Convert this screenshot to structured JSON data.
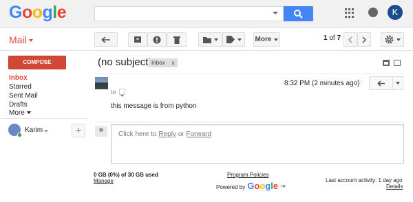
{
  "header": {
    "logo_letters": [
      "G",
      "o",
      "o",
      "g",
      "l",
      "e"
    ],
    "logo_colors": [
      "#4285f4",
      "#ea4335",
      "#fbbc05",
      "#4285f4",
      "#34a853",
      "#ea4335"
    ],
    "search": {
      "value": "",
      "placeholder": ""
    },
    "account_initial": "K"
  },
  "toolbar": {
    "mail_label": "Mail",
    "more_label": "More",
    "pager_current": "1",
    "pager_of": "of",
    "pager_total": "7"
  },
  "sidebar": {
    "compose_label": "COMPOSE",
    "items": [
      {
        "label": "Inbox"
      },
      {
        "label": "Starred"
      },
      {
        "label": "Sent Mail"
      },
      {
        "label": "Drafts"
      },
      {
        "label": "More"
      }
    ],
    "hangouts_user": "Karim"
  },
  "message": {
    "subject": "(no subject)",
    "label_chip": "Inbox",
    "label_close": "x",
    "to_label": "to",
    "time": "8:32 PM (2 minutes ago)",
    "body": "this message is from python",
    "reply_prompt_prefix": "Click here to ",
    "reply_link": "Reply",
    "reply_or": " or ",
    "forward_link": "Forward"
  },
  "footer": {
    "storage": "0 GB (0%) of 30 GB used",
    "manage": "Manage",
    "policies": "Program Policies",
    "powered_by": "Powered by",
    "powered_brand": "Google",
    "tm": "™",
    "activity": "Last account activity: 1 day ago",
    "details": "Details"
  },
  "colors": {
    "accent_red": "#dd4b39",
    "compose_bg": "#d14836",
    "search_blue": "#4285f4"
  }
}
